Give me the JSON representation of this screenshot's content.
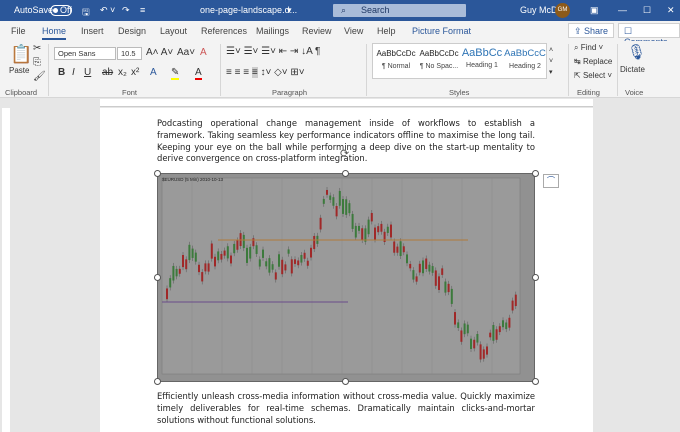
{
  "titlebar": {
    "autosave": "AutoSave",
    "autosave_state": "Off",
    "filename": "one-page-landscape.d...",
    "search": "Search",
    "user": "Guy McD",
    "initials": "GM"
  },
  "tabs": [
    "File",
    "Home",
    "Insert",
    "Design",
    "Layout",
    "References",
    "Mailings",
    "Review",
    "View",
    "Help",
    "Picture Format"
  ],
  "share": "Share",
  "comments": "Comments",
  "ribbon": {
    "paste": "Paste",
    "font_name": "Open Sans",
    "font_size": "10.5",
    "styles": [
      {
        "preview": "AaBbCcDc",
        "name": "¶ Normal"
      },
      {
        "preview": "AaBbCcDc",
        "name": "¶ No Spac..."
      },
      {
        "preview": "AaBbCc",
        "name": "Heading 1"
      },
      {
        "preview": "AaBbCcC",
        "name": "Heading 2"
      }
    ],
    "find": "Find",
    "replace": "Replace",
    "select": "Select",
    "dictate": "Dictate",
    "groups": [
      "Clipboard",
      "Font",
      "Paragraph",
      "Styles",
      "Editing",
      "Voice"
    ]
  },
  "document": {
    "para1": "Podcasting operational change management inside of workflows to establish a framework. Taking seamless key performance indicators offline to maximise the long tail. Keeping your eye on the ball while performing a deep dive on the start-up mentality to derive convergence on cross-platform integration.",
    "image_caption": "$EURUSD (5 Min) 2010-10-13",
    "para2": "Efficiently unleash cross-media information without cross-media value. Quickly maximize timely deliverables for real-time schemas. Dramatically maintain clicks-and-mortar solutions without functional solutions."
  }
}
